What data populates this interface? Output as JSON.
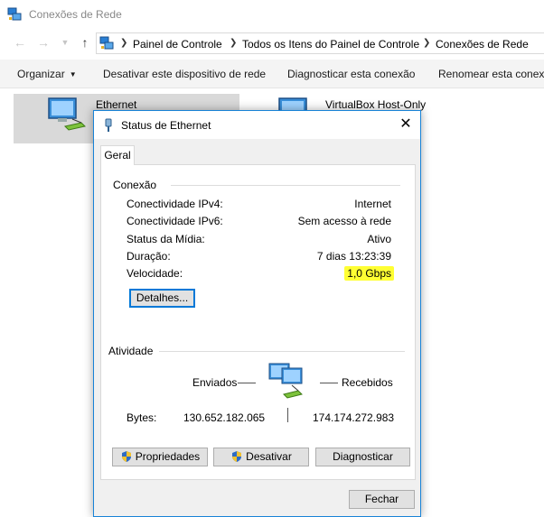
{
  "window": {
    "title": "Conexões de Rede"
  },
  "address": {
    "crumbs": [
      "Painel de Controle",
      "Todos os Itens do Painel de Controle",
      "Conexões de Rede"
    ]
  },
  "commandbar": {
    "organize": "Organizar",
    "disable": "Desativar este dispositivo de rede",
    "diagnose": "Diagnosticar esta conexão",
    "rename": "Renomear esta conexã"
  },
  "items": {
    "ethernet": "Ethernet",
    "virtualbox": "VirtualBox Host-Only"
  },
  "dialog": {
    "title": "Status de Ethernet",
    "tab": "Geral",
    "connection_group": "Conexão",
    "rows": [
      {
        "label": "Conectividade IPv4:",
        "value": "Internet"
      },
      {
        "label": "Conectividade IPv6:",
        "value": "Sem acesso à rede"
      },
      {
        "label": "Status da Mídia:",
        "value": "Ativo"
      },
      {
        "label": "Duração:",
        "value": "7 dias 13:23:39"
      },
      {
        "label": "Velocidade:",
        "value": "1,0 Gbps"
      }
    ],
    "details_button": "Detalhes...",
    "activity_group": "Atividade",
    "sent_label": "Enviados",
    "received_label": "Recebidos",
    "bytes_label": "Bytes:",
    "bytes_sent": "130.652.182.065",
    "bytes_received": "174.174.272.983",
    "properties_button": "Propriedades",
    "disable_button": "Desativar",
    "diagnose_button": "Diagnosticar",
    "close_button": "Fechar"
  },
  "colors": {
    "accent": "#1883d7",
    "highlight": "#ffff33",
    "selection": "#d9d9d9"
  }
}
